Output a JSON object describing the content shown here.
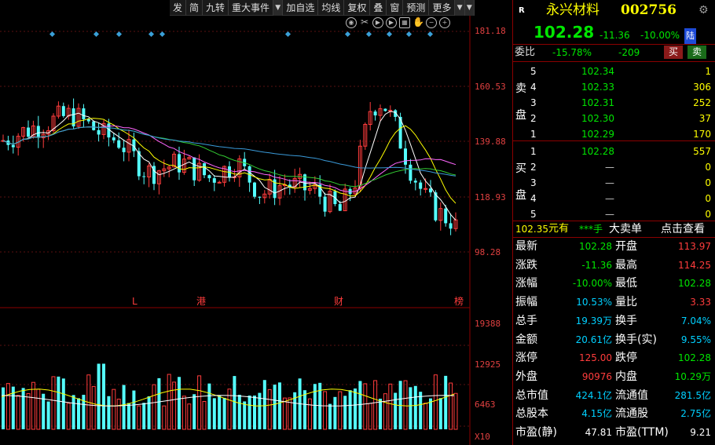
{
  "toolbar": {
    "buttons": [
      "发",
      "简",
      "九转",
      "重大事件",
      "加自选",
      "均线",
      "复权",
      "叠",
      "窗",
      "预测",
      "更多"
    ]
  },
  "chart": {
    "y_labels": [
      "181.18",
      "160.53",
      "139.88",
      "118.93",
      "98.28"
    ],
    "vol_labels": [
      "19388",
      "12925",
      "6463"
    ],
    "vol_unit": "X10",
    "markers": [
      "L",
      "港",
      "财",
      "榜"
    ]
  },
  "chart_data": [
    {
      "type": "candlestick",
      "ylim": [
        98.28,
        181.18
      ],
      "open": [
        135,
        140,
        128,
        150,
        145,
        130,
        138,
        132,
        120,
        126,
        125,
        112,
        115,
        122,
        113
      ],
      "close": [
        140,
        145,
        135,
        160,
        140,
        125,
        132,
        125,
        118,
        128,
        115,
        122,
        130,
        113,
        102.28
      ]
    },
    {
      "type": "bar",
      "ylim": [
        0,
        19388
      ],
      "values": [
        6000,
        7500,
        6200,
        8000,
        7000,
        5800,
        12000,
        6500,
        5500,
        7800,
        5200,
        6300,
        7000,
        8000,
        9800,
        6000,
        7200,
        19388
      ]
    }
  ],
  "stock": {
    "badge": "R",
    "name": "永兴材料",
    "code": "002756",
    "price": "102.28",
    "change": "-11.36",
    "pct": "-10.00%",
    "exchange": "陆"
  },
  "webi": {
    "label": "委比",
    "ratio": "-15.78%",
    "diff": "-209",
    "buy_btn": "买",
    "sell_btn": "卖"
  },
  "sell": {
    "label1": "卖",
    "label2": "盘",
    "rows": [
      {
        "lvl": "5",
        "price": "102.34",
        "vol": "1"
      },
      {
        "lvl": "4",
        "price": "102.33",
        "vol": "306"
      },
      {
        "lvl": "3",
        "price": "102.31",
        "vol": "252"
      },
      {
        "lvl": "2",
        "price": "102.30",
        "vol": "37"
      },
      {
        "lvl": "1",
        "price": "102.29",
        "vol": "170"
      }
    ]
  },
  "buy": {
    "label1": "买",
    "label2": "盘",
    "rows": [
      {
        "lvl": "1",
        "price": "102.28",
        "vol": "557"
      },
      {
        "lvl": "2",
        "price": "—",
        "vol": "0"
      },
      {
        "lvl": "3",
        "price": "—",
        "vol": "0"
      },
      {
        "lvl": "4",
        "price": "—",
        "vol": "0"
      },
      {
        "lvl": "5",
        "price": "—",
        "vol": "0"
      }
    ]
  },
  "bigtrade": {
    "price": "102.35",
    "unit": "元有",
    "vol": "***手",
    "label": "大卖单",
    "link": "点击查看"
  },
  "stats": [
    {
      "k1": "最新",
      "v1": "102.28",
      "c1": "green",
      "k2": "开盘",
      "v2": "113.97",
      "c2": "red"
    },
    {
      "k1": "涨跌",
      "v1": "-11.36",
      "c1": "green",
      "k2": "最高",
      "v2": "114.25",
      "c2": "red"
    },
    {
      "k1": "涨幅",
      "v1": "-10.00%",
      "c1": "green",
      "k2": "最低",
      "v2": "102.28",
      "c2": "green"
    },
    {
      "k1": "振幅",
      "v1": "10.53%",
      "c1": "cyan",
      "k2": "量比",
      "v2": "3.33",
      "c2": "red"
    },
    {
      "k1": "总手",
      "v1": "19.39万",
      "c1": "cyan",
      "k2": "换手",
      "v2": "7.04%",
      "c2": "cyan"
    },
    {
      "k1": "金额",
      "v1": "20.61亿",
      "c1": "cyan",
      "k2": "换手(实)",
      "v2": "9.55%",
      "c2": "cyan"
    },
    {
      "k1": "涨停",
      "v1": "125.00",
      "c1": "red",
      "k2": "跌停",
      "v2": "102.28",
      "c2": "green"
    },
    {
      "k1": "外盘",
      "v1": "90976",
      "c1": "red",
      "k2": "内盘",
      "v2": "10.29万",
      "c2": "green"
    },
    {
      "k1": "总市值",
      "v1": "424.1亿",
      "c1": "cyan",
      "k2": "流通值",
      "v2": "281.5亿",
      "c2": "cyan"
    },
    {
      "k1": "总股本",
      "v1": "4.15亿",
      "c1": "cyan",
      "k2": "流通股",
      "v2": "2.75亿",
      "c2": "cyan"
    },
    {
      "k1": "市盈(静)",
      "v1": "47.81",
      "c1": "white",
      "k2": "市盈(TTM)",
      "v2": "9.21",
      "c2": "white"
    }
  ]
}
